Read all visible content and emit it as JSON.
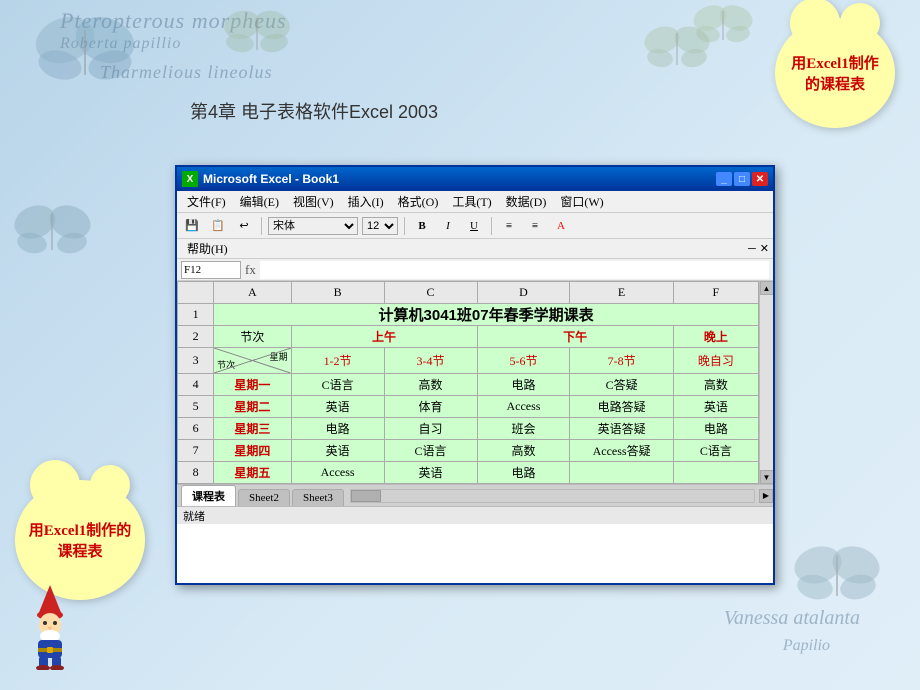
{
  "page": {
    "title": "第4章 电子表格软件Excel 2003",
    "deco_text_1": "Pteropterous morpheus",
    "deco_text_2": "Roberta papillio",
    "deco_text_3": "Tharmelious lineolus",
    "deco_text_4": "Vanessa atalanta",
    "deco_text_5": "Papilio"
  },
  "cloud_tr": {
    "text": "用Excel1制作的课程表"
  },
  "cloud_bl": {
    "text": "用Excel1制作的课程表"
  },
  "excel": {
    "title_bar": "Microsoft Excel - Book1",
    "title_icon": "X",
    "menus": [
      "文件(F)",
      "编辑(E)",
      "视图(V)",
      "插入(I)",
      "格式(O)",
      "工具(T)",
      "数据(D)",
      "窗口(W)"
    ],
    "help_menu": "帮助(H)",
    "font": "宋体",
    "font_size": "12",
    "cell_ref": "F12",
    "formula_symbol": "fx",
    "toolbar_buttons": [
      "B",
      "I",
      "U"
    ],
    "sheet_tabs": [
      "课程表",
      "Sheet2",
      "Sheet3"
    ],
    "status": "就绪"
  },
  "spreadsheet": {
    "col_headers": [
      "A",
      "B",
      "C",
      "D",
      "E",
      "F"
    ],
    "title_row": "计算机3041班07年春季学期课表",
    "rows": [
      {
        "row_num": "2",
        "cells": [
          "节次",
          "上午",
          "",
          "下午",
          "",
          "晚上"
        ]
      },
      {
        "row_num": "3",
        "cells": [
          "星期",
          "1-2节",
          "3-4节",
          "5-6节",
          "7-8节",
          "晚自习"
        ]
      },
      {
        "row_num": "4",
        "cells": [
          "星期一",
          "C语言",
          "高数",
          "电路",
          "C答疑",
          "高数"
        ]
      },
      {
        "row_num": "5",
        "cells": [
          "星期二",
          "英语",
          "体育",
          "Access",
          "电路答疑",
          "英语"
        ]
      },
      {
        "row_num": "6",
        "cells": [
          "星期三",
          "电路",
          "自习",
          "班会",
          "英语答疑",
          "电路"
        ]
      },
      {
        "row_num": "7",
        "cells": [
          "星期四",
          "英语",
          "C语言",
          "高数",
          "Access答疑",
          "C语言"
        ]
      },
      {
        "row_num": "8",
        "cells": [
          "星期五",
          "Access",
          "英语",
          "电路",
          "",
          ""
        ]
      }
    ]
  }
}
